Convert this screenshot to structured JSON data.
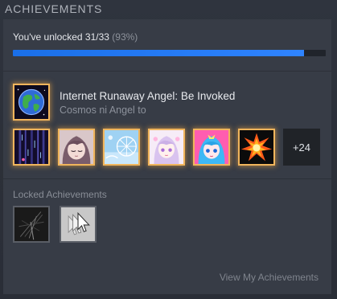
{
  "header": {
    "title": "ACHIEVEMENTS"
  },
  "progress": {
    "text": "You've unlocked 31/33",
    "percent_text": "(93%)",
    "fraction": 0.93
  },
  "featured_achievement": {
    "icon": "globe-icon",
    "title": "Internet Runaway Angel: Be Invoked",
    "description": "Cosmos ni Angel to"
  },
  "unlocked_icons": [
    {
      "icon": "rain-night-icon"
    },
    {
      "icon": "sleepy-girl-icon"
    },
    {
      "icon": "ferris-wheel-icon"
    },
    {
      "icon": "pastel-angel-icon"
    },
    {
      "icon": "blue-haired-angel-icon"
    },
    {
      "icon": "explosion-icon"
    }
  ],
  "more_count": "+24",
  "locked": {
    "label": "Locked Achievements",
    "icons": [
      {
        "icon": "locked-achievement-icon"
      },
      {
        "icon": "locked-achievement-icon"
      }
    ]
  },
  "footer": {
    "view_link": "View My Achievements"
  }
}
